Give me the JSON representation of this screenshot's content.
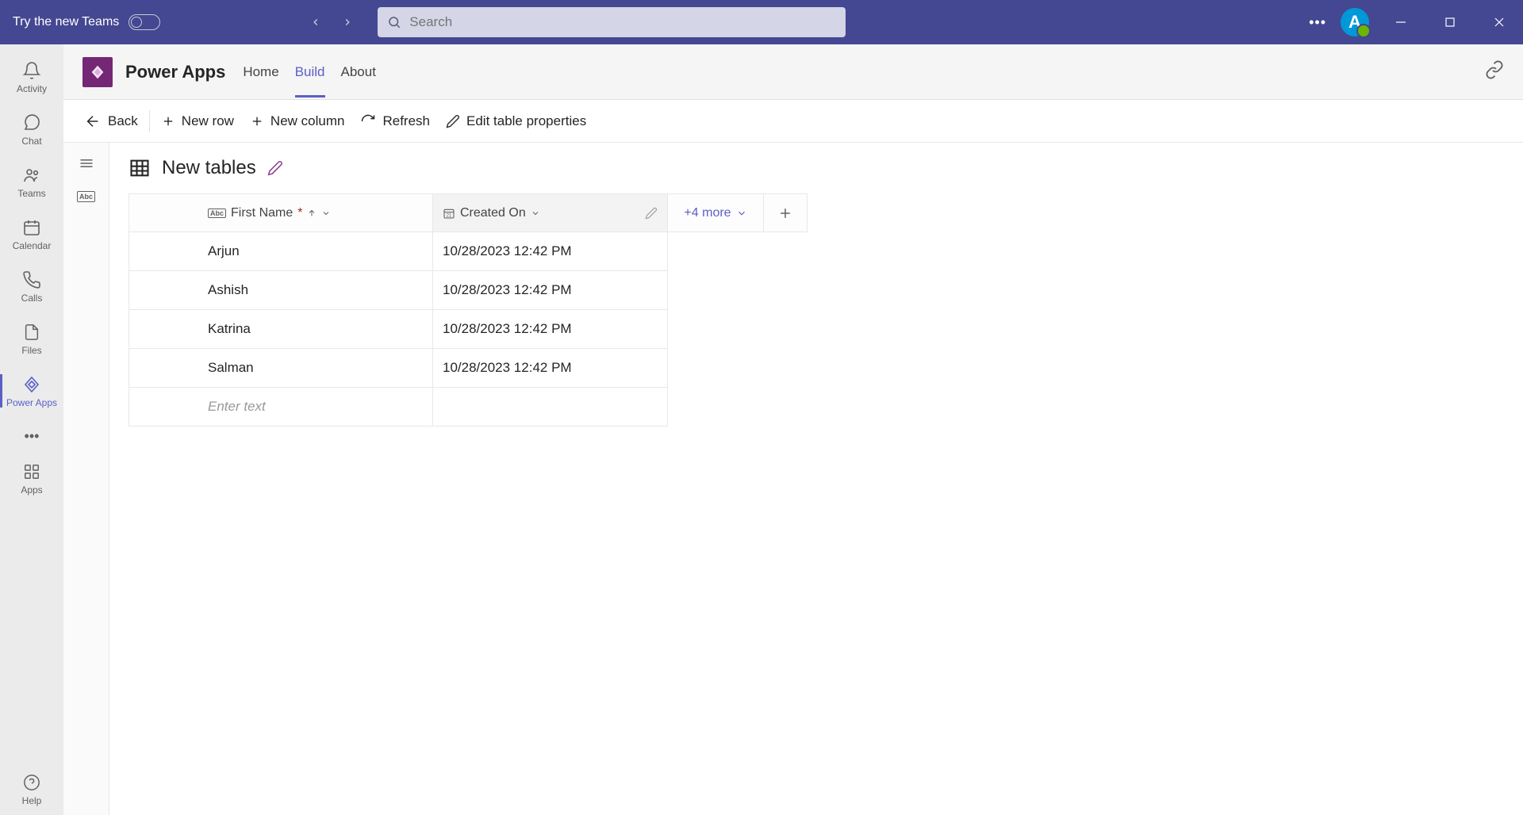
{
  "titlebar": {
    "try_teams": "Try the new Teams",
    "search_placeholder": "Search"
  },
  "avatar_letter": "A",
  "rail": {
    "activity": "Activity",
    "chat": "Chat",
    "teams": "Teams",
    "calendar": "Calendar",
    "calls": "Calls",
    "files": "Files",
    "powerapps": "Power Apps",
    "apps": "Apps",
    "help": "Help"
  },
  "app_header": {
    "title": "Power Apps",
    "tabs": {
      "home": "Home",
      "build": "Build",
      "about": "About"
    }
  },
  "toolbar": {
    "back": "Back",
    "new_row": "New row",
    "new_column": "New column",
    "refresh": "Refresh",
    "edit_props": "Edit table properties"
  },
  "table": {
    "title": "New tables",
    "col1": "First Name",
    "col2": "Created On",
    "more": "+4 more",
    "enter_text": "Enter text",
    "rows": [
      {
        "name": "Arjun",
        "date": "10/28/2023 12:42 PM"
      },
      {
        "name": "Ashish",
        "date": "10/28/2023 12:42 PM"
      },
      {
        "name": "Katrina",
        "date": "10/28/2023 12:42 PM"
      },
      {
        "name": "Salman",
        "date": "10/28/2023 12:42 PM"
      }
    ]
  },
  "sub_side": {
    "abc": "Abc"
  }
}
